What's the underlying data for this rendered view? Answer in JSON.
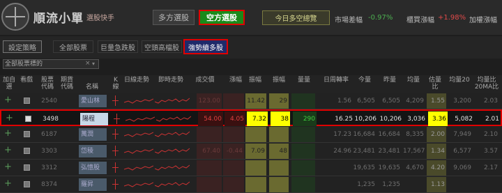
{
  "app": {
    "name": "順流小單",
    "subtitle": "選股快手"
  },
  "mode": {
    "long_label": "多方選股",
    "short_label": "空方選股"
  },
  "market": {
    "today_label": "今日多空總覽",
    "index_label": "市場差幅",
    "index_value": "-0.97%",
    "counter_label": "櫃買漲幅",
    "counter_value": "+1.98%",
    "weighted_label": "加權漲幅"
  },
  "tabs": {
    "settings_label": "設定策略",
    "categories": [
      "全部股票",
      "巨量急跌股",
      "空頭高檔股",
      "強勢續多股"
    ]
  },
  "filter": {
    "value": "全部股票標的",
    "clear": "×",
    "arrow": "▾"
  },
  "columns": {
    "add": "加自選",
    "watch": "看戲",
    "code": "股票代碼",
    "futures": "期貨代碼",
    "name": "名稱",
    "k": "K線",
    "trend": "日線走勢",
    "intraday": "即時走勢",
    "close": "成交價",
    "change": "漲幅",
    "pct": "振幅",
    "amp": "振幅",
    "vol_ratio": "量量",
    "turnover": "日周轉率",
    "today_vol": "今量",
    "yest_vol": "昨量",
    "avg_vol": "均量",
    "est_ratio": "估量比",
    "est_pct": "估量比",
    "ma20": "均量20",
    "ma20_over": "均量比20MA比"
  },
  "rows": [
    {
      "code": "2540",
      "name": "愛山林",
      "close": "123.00",
      "change": "",
      "r1": "11.42",
      "r2": "29",
      "vol": "",
      "turnover": "1.56",
      "today": "6,505",
      "yest": "6,505",
      "avg": "4,209",
      "est": "1.55",
      "ma": "3,200",
      "ratio": "2.03",
      "selected": false
    },
    {
      "code": "3498",
      "name": "陽程",
      "close": "54.00",
      "change": "4.05",
      "r1": "7.32",
      "r2": "38",
      "vol": "290",
      "turnover": "16.25",
      "today": "10,206",
      "yest": "10,206",
      "avg": "3,036",
      "est": "3.36",
      "ma": "5,082",
      "ratio": "2.01",
      "selected": true
    },
    {
      "code": "6187",
      "name": "萬潤",
      "close": "",
      "change": "",
      "r1": "",
      "r2": "",
      "vol": "",
      "turnover": "17.23",
      "today": "16,684",
      "yest": "16,684",
      "avg": "8,335",
      "est": "2.00",
      "ma": "7,949",
      "ratio": "2.10",
      "selected": false
    },
    {
      "code": "3303",
      "name": "岱稜",
      "close": "67.40",
      "change": "-0.44",
      "r1": "7.09",
      "r2": "48",
      "vol": "",
      "turnover": "24.96",
      "today": "23,481",
      "yest": "23,481",
      "avg": "17,567",
      "est": "1.34",
      "ma": "6,577",
      "ratio": "3.57",
      "selected": false
    },
    {
      "code": "3312",
      "name": "弘憶股",
      "close": "",
      "change": "",
      "r1": "",
      "r2": "",
      "vol": "",
      "turnover": "",
      "today": "19,635",
      "yest": "19,635",
      "avg": "4,670",
      "est": "4.20",
      "ma": "9,069",
      "ratio": "2.17",
      "selected": false
    },
    {
      "code": "8374",
      "name": "羅昇",
      "close": "",
      "change": "",
      "r1": "",
      "r2": "",
      "vol": "",
      "turnover": "",
      "today": "1,235",
      "yest": "1,235",
      "avg": "",
      "est": "1.13",
      "ma": "",
      "ratio": "",
      "selected": false
    }
  ],
  "colors": {
    "accent": "#e00000",
    "active_mode": "#1a8a1a",
    "highlight": "#ffff00"
  }
}
